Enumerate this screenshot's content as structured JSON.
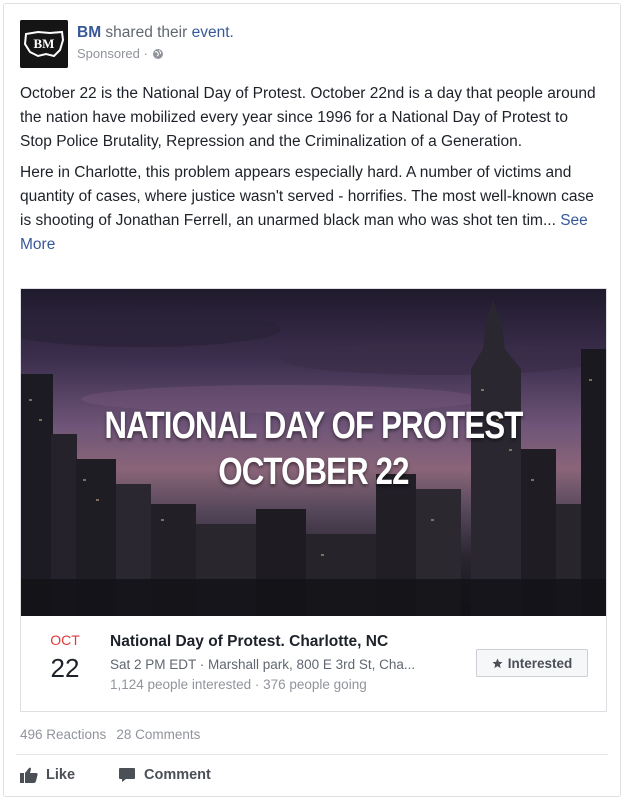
{
  "post": {
    "page_name": "BM",
    "shared_text": "shared their",
    "event_link": "event.",
    "sponsored": "Sponsored ·",
    "avatar_text": "BM",
    "paragraphs": [
      "October 22 is the National Day of Protest. October 22nd is a day that people around the nation have mobilized every year since 1996 for a National Day of Protest to Stop Police Brutality, Repression and the Criminalization of a Generation.",
      "Here in Charlotte, this problem appears especially hard. A number of victims and quantity of cases, where justice wasn't served - horrifies. The most well-known case is shooting of Jonathan Ferrell, an unarmed black man who was shot ten tim..."
    ],
    "see_more": "See More"
  },
  "event": {
    "cover_line1": "NATIONAL DAY OF PROTEST",
    "cover_line2": "OCTOBER 22",
    "month": "OCT",
    "day": "22",
    "title": "National Day of Protest. Charlotte, NC",
    "meta": "Sat 2 PM EDT · Marshall park, 800 E 3rd St, Cha...",
    "stats": "1,124 people interested · 376 people going",
    "interested_label": "Interested"
  },
  "footer": {
    "reactions": "496 Reactions",
    "comments": "28 Comments",
    "like_label": "Like",
    "comment_label": "Comment"
  },
  "colors": {
    "link": "#365899",
    "month": "#e0393e"
  },
  "icons": [
    "globe-icon",
    "star-icon",
    "like-icon",
    "comment-icon"
  ]
}
